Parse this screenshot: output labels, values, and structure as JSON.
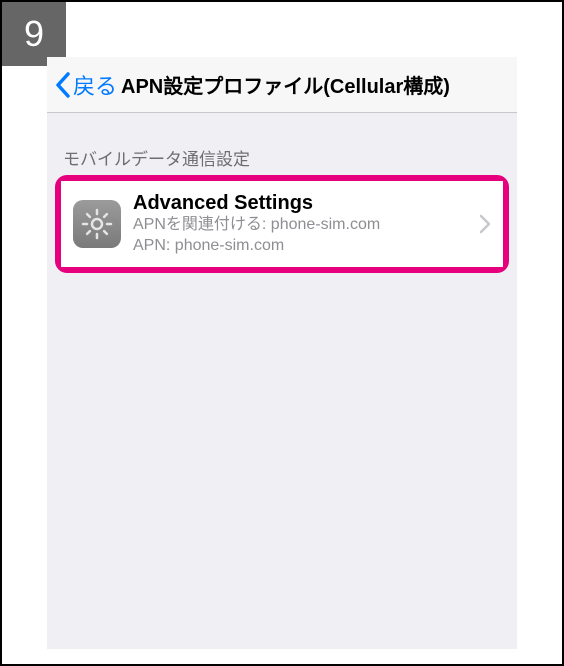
{
  "step_number": "9",
  "nav": {
    "back_label": "戻る",
    "title": "APN設定プロファイル(Cellular構成)"
  },
  "section_header": "モバイルデータ通信設定",
  "cell": {
    "title": "Advanced Settings",
    "subtitle1": "APNを関連付ける: phone-sim.com",
    "subtitle2": "APN: phone-sim.com"
  }
}
